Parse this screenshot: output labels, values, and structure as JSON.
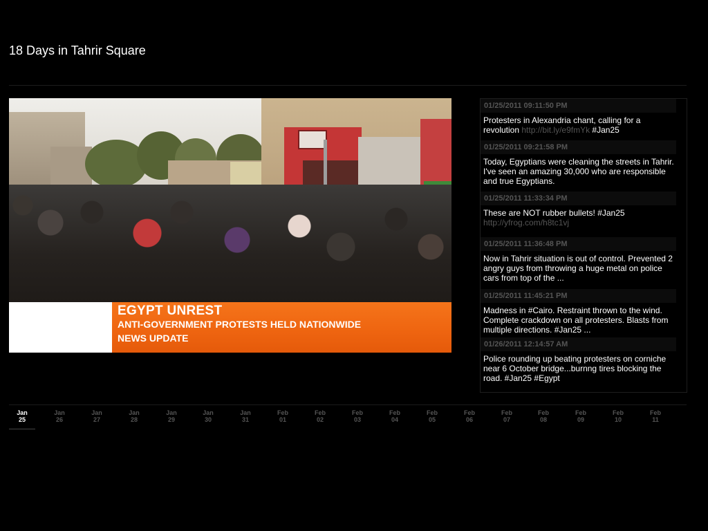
{
  "page": {
    "title": "18 Days in Tahrir Square"
  },
  "video": {
    "lower_third": {
      "headline": "EGYPT UNREST",
      "subheadline": "ANTI-GOVERNMENT PROTESTS HELD NATIONWIDE",
      "tag": "NEWS UPDATE"
    },
    "colors": {
      "banner_orange": "#ee6410",
      "banner_white": "#ffffff"
    }
  },
  "tweets": [
    {
      "time": "01/25/2011 09:11:50 PM",
      "text": "Protesters in Alexandria chant, calling for a revolution ",
      "link": "http://bit.ly/e9fmYk",
      "tail": " #Jan25"
    },
    {
      "time": "01/25/2011 09:21:58 PM",
      "text": "Today, Egyptians were cleaning the streets in Tahrir. I've seen an amazing 30,000 who are responsible and true Egyptians.",
      "link": "",
      "tail": ""
    },
    {
      "time": "01/25/2011 11:33:34 PM",
      "text": "These are NOT rubber bullets! #Jan25 ",
      "link": "http://yfrog.com/h8tc1vj",
      "tail": ""
    },
    {
      "time": "01/25/2011 11:36:48 PM",
      "text": "Now in Tahrir situation is out of control. Prevented 2 angry guys from throwing a huge metal on police cars from top of the ...",
      "link": "",
      "tail": ""
    },
    {
      "time": "01/25/2011 11:45:21 PM",
      "text": "Madness in #Cairo. Restraint thrown to the wind. Complete crackdown on all protesters. Blasts from multiple directions. #Jan25 ...",
      "link": "",
      "tail": ""
    },
    {
      "time": "01/26/2011 12:14:57 AM",
      "text": "Police rounding up beating protesters on corniche near 6 October bridge...burnng tires blocking the road. #Jan25 #Egypt",
      "link": "",
      "tail": ""
    }
  ],
  "timeline": {
    "active_index": 0,
    "days": [
      {
        "month": "Jan",
        "day": "25"
      },
      {
        "month": "Jan",
        "day": "26"
      },
      {
        "month": "Jan",
        "day": "27"
      },
      {
        "month": "Jan",
        "day": "28"
      },
      {
        "month": "Jan",
        "day": "29"
      },
      {
        "month": "Jan",
        "day": "30"
      },
      {
        "month": "Jan",
        "day": "31"
      },
      {
        "month": "Feb",
        "day": "01"
      },
      {
        "month": "Feb",
        "day": "02"
      },
      {
        "month": "Feb",
        "day": "03"
      },
      {
        "month": "Feb",
        "day": "04"
      },
      {
        "month": "Feb",
        "day": "05"
      },
      {
        "month": "Feb",
        "day": "06"
      },
      {
        "month": "Feb",
        "day": "07"
      },
      {
        "month": "Feb",
        "day": "08"
      },
      {
        "month": "Feb",
        "day": "09"
      },
      {
        "month": "Feb",
        "day": "10"
      },
      {
        "month": "Feb",
        "day": "11"
      }
    ],
    "colors": {
      "active": "#ffffff",
      "inactive": "#555555"
    }
  }
}
